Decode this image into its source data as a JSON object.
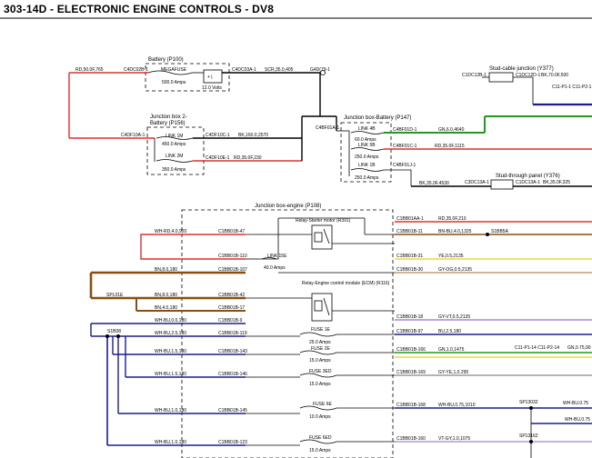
{
  "header": {
    "title": "303-14D - ELECTRONIC ENGINE CONTROLS - DV8"
  },
  "colors": {
    "red": "#e0302b",
    "black": "#000000",
    "green": "#1f9a1f",
    "navy": "#1c1c8c",
    "brown": "#8a4e12",
    "tan": "#c49a78",
    "violet": "#b69ad6",
    "yellow": "#e9dc3a",
    "grey": "#9a9a9a"
  },
  "components": {
    "battery": {
      "title": "Battery (P100)",
      "fuse": "MEGAFUSE",
      "rating": "500.0 Amps",
      "voltage": "12.0 Volts",
      "pin_in": "C4DC02B-1",
      "pin_out": "C4DC03A-1",
      "ground": "G4D(79-1",
      "wire_in": "RD,50.0F,765",
      "wire_out": "SCR,35.0,405"
    },
    "jb2": {
      "title": "Junction box 2-",
      "title2": "Battery (P156)",
      "link1": "LINK 1M",
      "link1_rating": "450.0 Amps",
      "link2": "LINK 2M",
      "link2_rating": "350.0 Amps",
      "pin_in": "C4DF10A-1",
      "pin1": "C4DF10C-1",
      "pin2": "C4DF10E-1",
      "wire1": "BK,160.0,2570",
      "wire2": "RD,35.0F,230"
    },
    "jbb": {
      "title": "Junction box-Battery (P147)",
      "pin_in": "C4BF01A-1",
      "link1": "LINK 4B",
      "link1_rating": "60.0 Amps",
      "link2": "LINK 5B",
      "link2_rating": "250.0 Amps",
      "link3": "LINK 1B",
      "link3_rating": "250.0 Amps",
      "pin1": "C4BF01D-1",
      "pin2": "C4BF01C-1",
      "pin3": "C4BF01J-1",
      "wire1": "GN,6.0,4640",
      "wire2": "RD,35.0F,1115",
      "wire3": "BK,35.0F,4530"
    },
    "stud_cable": {
      "title": "Stud-cable junction (Y377)",
      "pin_a": "C1DC12B-1",
      "pin_b": "C1DC12D-1",
      "wire": "BK,70.0F,500",
      "pin_c": "C11-P1-1 C11-P2-1"
    },
    "stud_panel": {
      "title": "Stud-through panel (Y376)",
      "pin_a": "C3DC13A-1",
      "pin_b": "C1DC13A-1",
      "wire": "BK,35.0F,325"
    },
    "jbe": {
      "title": "Junction box-engine (P108)",
      "relay1": "Relay-Starter motor (R391)",
      "relay2": "Relay-Engine control module (ECM) (R116)",
      "link": "LINK 15E",
      "link_rating": "40.0 Amps",
      "fuse1": "FUSE 1E",
      "fuse1_rating": "25.0 Amps",
      "fuse2": "FUSE 2E",
      "fuse2_rating": "15.0 Amps",
      "fuse3": "FUSE 3ED",
      "fuse3_rating": "15.0 Amps",
      "fuse4": "FUSE 6E",
      "fuse4_rating": "10.0 Amps",
      "fuse5": "FUSE 6ED",
      "fuse5_rating": "15.0 Amps"
    }
  },
  "left_pins": [
    "C1BB01B-47",
    "C1BB01B-110",
    "C1BB01B-107",
    "C1BB01B-42",
    "C1BB01B-17",
    "C1BB01B-9",
    "C1BB01B-119",
    "C1BB01B-143",
    "C1BB01B-146",
    "C1BB01B-145",
    "C1BB01B-123"
  ],
  "left_wires": [
    "WH-RD,4.0,920",
    "BN,8.0,180",
    "BN,8.0,180",
    "BN,4.0,180",
    "WH-BU,0.0,180",
    "WH-BU,2.5,180",
    "WH-BU,1.5,180",
    "WH-BU,1.5,180",
    "WH-BU,1.0,180",
    "WH-BU,1.0,180"
  ],
  "right_pins": [
    "C1BB01AA-1",
    "C1BB01B-11",
    "C1BB01B-31",
    "C1BB01B-30",
    "C1BB01B-18",
    "C1BB01B-97",
    "C1BB01B-166",
    "C1BB01B-169",
    "C1BB01B-168",
    "C1BB01B-160"
  ],
  "right_wires": [
    "RD,35.0F,210",
    "BN-BU,4.0,1325",
    "YE,0.5,2135",
    "GY-OG,0.5,2135",
    "GY-VT,0.5,2135",
    "BU,2.5,180",
    "GN,1.0,1475",
    "GY-YE,1,0.295",
    "WH-BU,0.75,1010",
    "VT-GY,1.0,1075"
  ],
  "splices": {
    "spl01e": "SPL01E",
    "s1b08": "S1B08",
    "s1bb5a": "S1BB5A",
    "sp13032": "SP13032",
    "sp13162": "SP13162"
  },
  "far_right": {
    "c11": "C11-P1-14 C11-P2-14",
    "gn": "GN,0.75,90",
    "wh": "WH-BU,0.75",
    "wh2": "WH-BU,0.75"
  }
}
